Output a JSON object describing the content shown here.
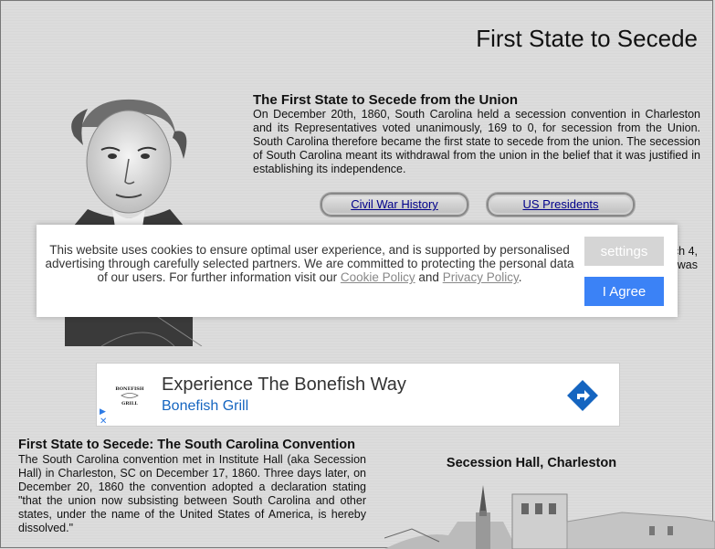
{
  "page": {
    "title": "First State to Secede"
  },
  "intro": {
    "heading": "The First State to Secede from the Union",
    "body": "On December 20th, 1860, South Carolina held a secession convention in Charleston and its Representatives voted unanimously, 169 to 0, for secession from the Union. South Carolina therefore became the first state to secede from the union. The secession  of South Carolina meant its withdrawal from the union in the belief that it was justified in establishing its independence."
  },
  "nav": {
    "civil_war": "Civil War History",
    "presidents": "US Presidents"
  },
  "partial": {
    "line1": "ch 4,",
    "line2": "was"
  },
  "cookie": {
    "text_before": "This website uses cookies to ensure optimal user experience, and is supported by personalised advertising through carefully selected partners. We are committed to protecting the personal data of our users. For further information visit our ",
    "cookie_link": "Cookie Policy",
    "and": " and ",
    "privacy_link": "Privacy Policy",
    "end": ".",
    "settings_label": "settings",
    "agree_label": "I Agree"
  },
  "ad": {
    "logo_text": "BONEFISH GRILL",
    "headline": "Experience The Bonefish Way",
    "advertiser": "Bonefish Grill",
    "close": "✕",
    "adchoices": "▶"
  },
  "convention": {
    "heading": "First State to Secede: The South Carolina Convention",
    "body": "The South Carolina convention met in Institute Hall (aka Secession Hall) in Charleston, SC on December 17, 1860. Three days later, on December 20, 1860 the convention adopted a declaration stating \"that the union now subsisting between South Carolina and other states, under the name of the United States of America, is hereby dissolved.\""
  },
  "hall": {
    "caption": "Secession Hall, Charleston"
  },
  "colors": {
    "agree_button": "#3b82f6",
    "settings_button": "#d5d5d5",
    "link": "#00008b",
    "ad_advertiser": "#1565c0"
  }
}
